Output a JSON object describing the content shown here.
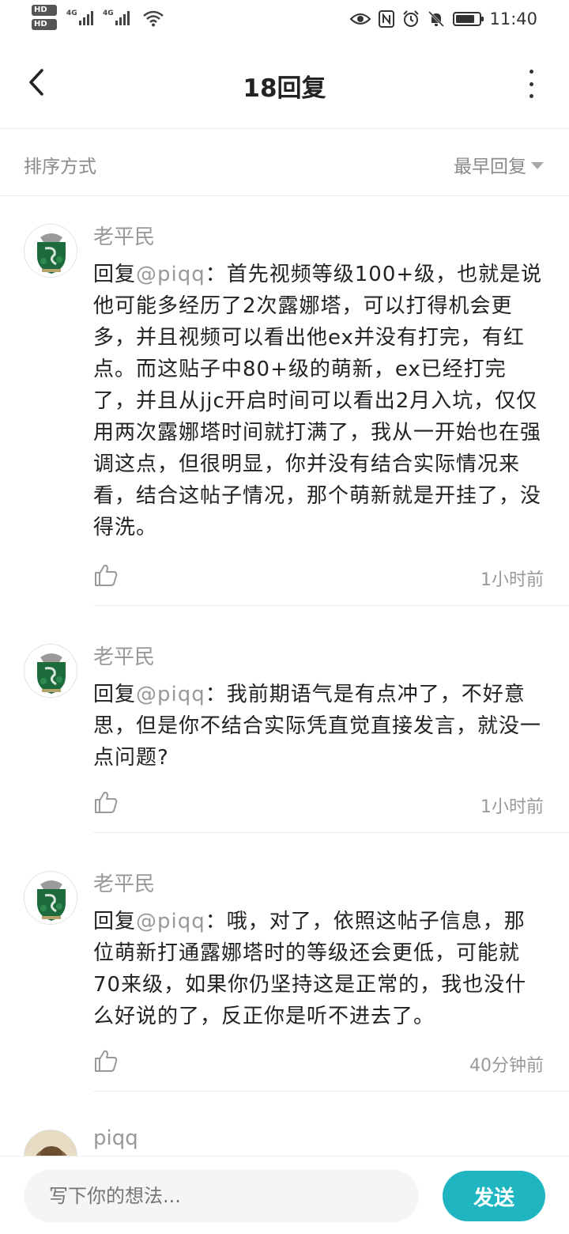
{
  "status_bar": {
    "sim1": "HD 1",
    "sim2": "HD 2",
    "network1": "4G",
    "network2": "4G",
    "time": "11:40",
    "icons": [
      "eye-icon",
      "nfc-icon",
      "alarm-icon",
      "mute-icon",
      "battery-icon"
    ]
  },
  "header": {
    "title": "18回复",
    "back_icon": "chevron-left-icon",
    "more_icon": "more-vertical-icon"
  },
  "sort": {
    "label": "排序方式",
    "selected": "最早回复"
  },
  "comments": [
    {
      "author": "老平民",
      "prefix": "回复",
      "mention": "@piqq",
      "text": "：首先视频等级100+级，也就是说他可能多经历了2次露娜塔，可以打得机会更多，并且视频可以看出他ex并没有打完，有红点。而这贴子中80+级的萌新，ex已经打完了，并且从jjc开启时间可以看出2月入坑，仅仅用两次露娜塔时间就打满了，我从一开始也在强调这点，但很明显，你并没有结合实际情况来看，结合这帖子情况，那个萌新就是开挂了，没得洗。",
      "time": "1小时前"
    },
    {
      "author": "老平民",
      "prefix": "回复",
      "mention": "@piqq",
      "text": "：我前期语气是有点冲了，不好意思，但是你不结合实际凭直觉直接发言，就没一点问题?",
      "time": "1小时前"
    },
    {
      "author": "老平民",
      "prefix": "回复",
      "mention": "@piqq",
      "text": "：哦，对了，依照这帖子信息，那位萌新打通露娜塔时的等级还会更低，可能就70来级，如果你仍坚持这是正常的，我也没什么好说的了，反正你是听不进去了。",
      "time": "40分钟前"
    },
    {
      "author": "piqq"
    }
  ],
  "compose": {
    "placeholder": "写下你的想法...",
    "send_label": "发送"
  },
  "colors": {
    "accent": "#1fb6c2",
    "muted_text": "#999999",
    "divider": "#ececec"
  }
}
